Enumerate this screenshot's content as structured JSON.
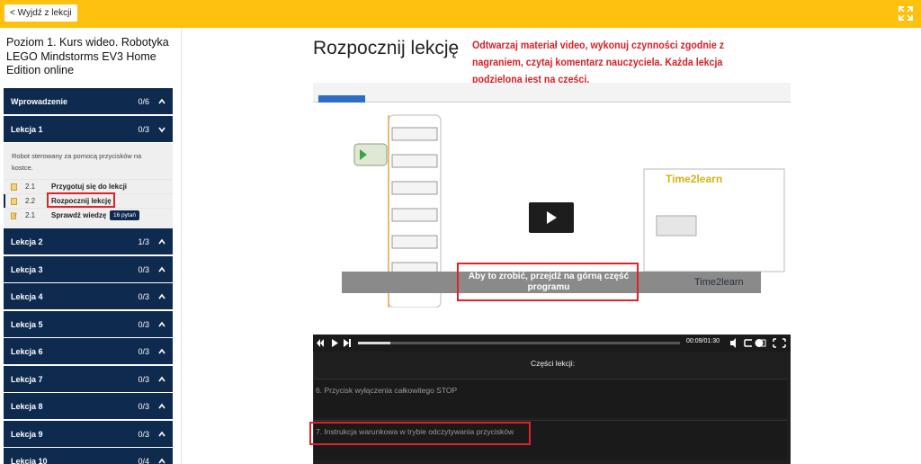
{
  "topbar": {
    "exit_label": "< Wyjdź z lekcji",
    "fullscreen_icon": "expand-icon",
    "bg_color": "#fec10f"
  },
  "sidebar": {
    "course_title": "Poziom 1. Kurs wideo. Robotyka LEGO Mindstorms EV3 Home Edition online",
    "sections": [
      {
        "label": "Wprowadzenie",
        "count": "0/6",
        "expanded": false
      },
      {
        "label": "Lekcja 1",
        "count": "0/3",
        "expanded": true
      },
      {
        "label": "Lekcja 2",
        "count": "1/3",
        "expanded": false
      },
      {
        "label": "Lekcja 3",
        "count": "0/3",
        "expanded": false
      },
      {
        "label": "Lekcja 4",
        "count": "0/3",
        "expanded": false
      },
      {
        "label": "Lekcja 5",
        "count": "0/3",
        "expanded": false
      },
      {
        "label": "Lekcja 6",
        "count": "0/3",
        "expanded": false
      },
      {
        "label": "Lekcja 7",
        "count": "0/3",
        "expanded": false
      },
      {
        "label": "Lekcja 8",
        "count": "0/3",
        "expanded": false
      },
      {
        "label": "Lekcja 9",
        "count": "0/3",
        "expanded": false
      },
      {
        "label": "Lekcja 10",
        "count": "0/4",
        "expanded": false
      }
    ],
    "lesson1": {
      "description": "Robot sterowany za pomocą przycisków na kostce.",
      "items": [
        {
          "num": "2.1",
          "label": "Przygotuj się do lekcji",
          "icon": "document-icon"
        },
        {
          "num": "2.2",
          "label": "Rozpocznij lekcję",
          "icon": "document-icon",
          "active": true
        },
        {
          "num": "2.1",
          "label": "Sprawdź wiedzę",
          "icon": "edit-icon",
          "badge": "16 pytań"
        }
      ]
    }
  },
  "main": {
    "title": "Rozpocznij lekcję",
    "intro": "Odtwarzaj materiał video, wykonuj czynności zgodnie z nagraniem, czytaj komentarz nauczyciela. Każda lekcja podzielona jest na części.",
    "video": {
      "caption": "Aby to zrobić, przejdź na górną część programu",
      "logo": "Time2learn",
      "time": "00:09/01:30",
      "progress": 0.1
    },
    "parts": {
      "title": "Części lekcji:",
      "items": [
        "6. Przycisk wyłączenia całkowitego STOP",
        "7. Instrukcja warunkowa w trybie odczytywania przycisków"
      ]
    },
    "accent_red": "#d81f26",
    "navy": "#0f2a4f"
  }
}
